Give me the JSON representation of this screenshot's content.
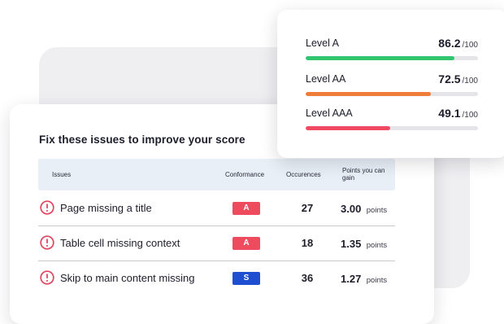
{
  "issues_panel": {
    "title": "Fix these issues to improve your score",
    "columns": {
      "issues": "Issues",
      "conformance": "Conformance",
      "occurrences": "Occurences",
      "points": "Points you can gain"
    },
    "rows": [
      {
        "issue": "Page missing a title",
        "conformance": "A",
        "occurrences": "27",
        "points": "3.00",
        "points_unit": "points",
        "badge_color": "#ee4b5f"
      },
      {
        "issue": "Table cell missing context",
        "conformance": "A",
        "occurrences": "18",
        "points": "1.35",
        "points_unit": "points",
        "badge_color": "#ee4b5f"
      },
      {
        "issue": "Skip to main content missing",
        "conformance": "S",
        "occurrences": "36",
        "points": "1.27",
        "points_unit": "points",
        "badge_color": "#1e4fd1"
      }
    ],
    "icon": "alert-circle-icon",
    "icon_color": "#e2445c"
  },
  "score_panel": {
    "levels": [
      {
        "label": "Level A",
        "score": "86.2",
        "max": "/100",
        "fraction": 0.862,
        "color": "#33c46f"
      },
      {
        "label": "Level AA",
        "score": "72.5",
        "max": "/100",
        "fraction": 0.725,
        "color": "#f07c3a"
      },
      {
        "label": "Level AAA",
        "score": "49.1",
        "max": "/100",
        "fraction": 0.491,
        "color": "#ef4a62"
      }
    ]
  }
}
